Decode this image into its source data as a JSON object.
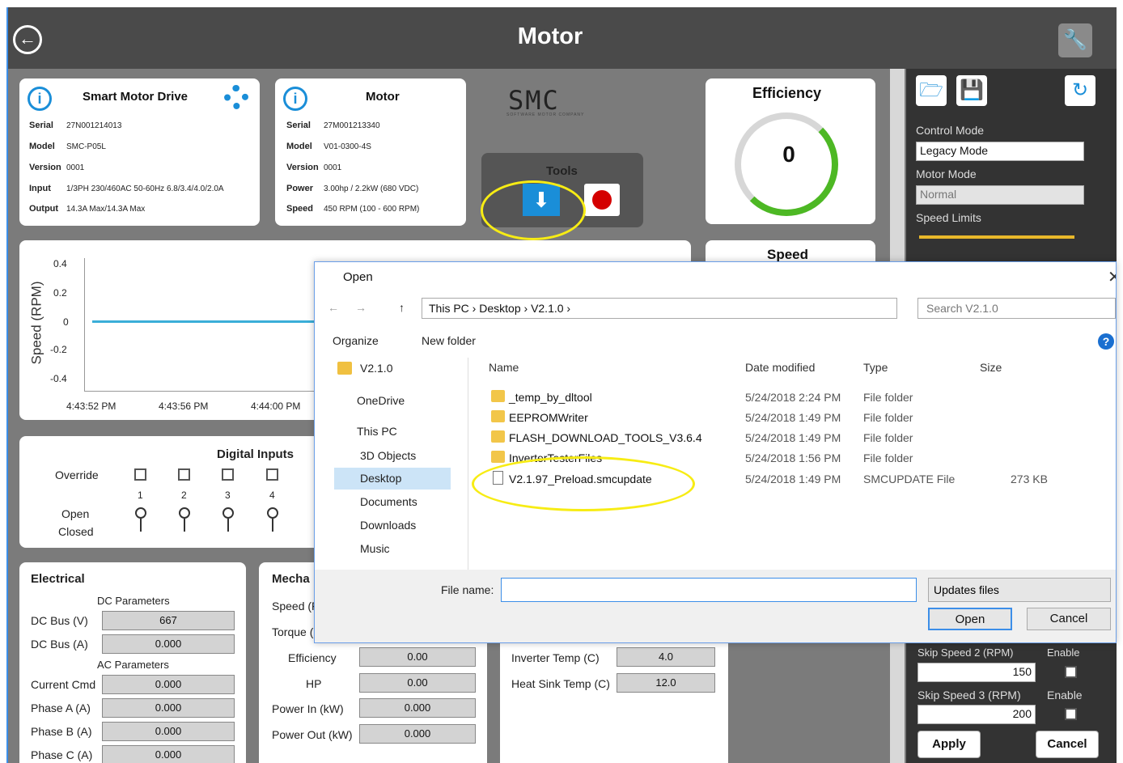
{
  "app": {
    "title": "Motor"
  },
  "drive": {
    "title": "Smart Motor Drive",
    "rows": [
      {
        "k": "Serial",
        "v": "27N001214013"
      },
      {
        "k": "Model",
        "v": "SMC-P05L"
      },
      {
        "k": "Version",
        "v": "0001"
      },
      {
        "k": "Input",
        "v": "1/3PH 230/460AC 50-60Hz 6.8/3.4/4.0/2.0A"
      },
      {
        "k": "Output",
        "v": "14.3A Max/14.3A Max"
      }
    ]
  },
  "motor": {
    "title": "Motor",
    "rows": [
      {
        "k": "Serial",
        "v": "27M001213340"
      },
      {
        "k": "Model",
        "v": "V01-0300-4S"
      },
      {
        "k": "Version",
        "v": "0001"
      },
      {
        "k": "Power",
        "v": "3.00hp / 2.2kW (680 VDC)"
      },
      {
        "k": "Speed",
        "v": "450 RPM (100 - 600 RPM)"
      }
    ]
  },
  "logo": {
    "text": "SMC",
    "tagline": "SOFTWARE MOTOR COMPANY"
  },
  "tools": {
    "label": "Tools"
  },
  "efficiency": {
    "title": "Efficiency",
    "value": "0"
  },
  "speed_card": {
    "title": "Speed"
  },
  "chart": {
    "ylabel": "Speed (RPM)",
    "yticks": [
      "0.4",
      "0.2",
      "0",
      "-0.2",
      "-0.4"
    ],
    "xticks": [
      "4:43:52 PM",
      "4:43:56 PM",
      "4:44:00 PM"
    ]
  },
  "digital": {
    "title": "Digital Inputs",
    "override": "Override",
    "open": "Open",
    "closed": "Closed",
    "nums": [
      "1",
      "2",
      "3",
      "4"
    ]
  },
  "electrical": {
    "title": "Electrical",
    "dc": "DC Parameters",
    "ac": "AC Parameters",
    "rows": [
      {
        "k": "DC Bus (V)",
        "v": "667"
      },
      {
        "k": "DC Bus (A)",
        "v": "0.000"
      },
      {
        "k": "Current Cmd",
        "v": "0.000"
      },
      {
        "k": "Phase A (A)",
        "v": "0.000"
      },
      {
        "k": "Phase B (A)",
        "v": "0.000"
      },
      {
        "k": "Phase C (A)",
        "v": "0.000"
      }
    ]
  },
  "mech": {
    "title": "Mecha",
    "speed": "Speed (F",
    "torque": "Torque (",
    "rows": [
      {
        "k": "Efficiency",
        "v": "0.00"
      },
      {
        "k": "HP",
        "v": "0.00"
      },
      {
        "k": "Power In (kW)",
        "v": "0.000"
      },
      {
        "k": "Power Out (kW)",
        "v": "0.000"
      }
    ]
  },
  "temps": [
    {
      "k": "Inverter Temp (C)",
      "v": "4.0"
    },
    {
      "k": "Heat Sink Temp (C)",
      "v": "12.0"
    }
  ],
  "side": {
    "control_mode_label": "Control Mode",
    "control_mode": "Legacy Mode",
    "motor_mode_label": "Motor Mode",
    "motor_mode": "Normal",
    "speed_limits": "Speed Limits",
    "skip2": "Skip Speed 2 (RPM)",
    "enable": "Enable",
    "skip2_val": "150",
    "skip3": "Skip Speed 3 (RPM)",
    "skip3_val": "200",
    "apply": "Apply",
    "cancel": "Cancel"
  },
  "dialog": {
    "title": "Open",
    "path": [
      "This PC",
      "Desktop",
      "V2.1.0"
    ],
    "search_placeholder": "Search V2.1.0",
    "organize": "Organize",
    "new_folder": "New folder",
    "nav": [
      "V2.1.0",
      "OneDrive",
      "This PC",
      "3D Objects",
      "Desktop",
      "Documents",
      "Downloads",
      "Music"
    ],
    "columns": {
      "name": "Name",
      "date": "Date modified",
      "type": "Type",
      "size": "Size"
    },
    "files": [
      {
        "name": "_temp_by_dltool",
        "date": "5/24/2018 2:24 PM",
        "type": "File folder",
        "size": ""
      },
      {
        "name": "EEPROMWriter",
        "date": "5/24/2018 1:49 PM",
        "type": "File folder",
        "size": ""
      },
      {
        "name": "FLASH_DOWNLOAD_TOOLS_V3.6.4",
        "date": "5/24/2018 1:49 PM",
        "type": "File folder",
        "size": ""
      },
      {
        "name": "InverterTesterFiles",
        "date": "5/24/2018 1:56 PM",
        "type": "File folder",
        "size": ""
      },
      {
        "name": "V2.1.97_Preload.smcupdate",
        "date": "5/24/2018 1:49 PM",
        "type": "SMCUPDATE File",
        "size": "273 KB"
      }
    ],
    "file_name_label": "File name:",
    "file_name": "",
    "filter": "Updates files",
    "open": "Open",
    "cancel": "Cancel"
  },
  "colors": {
    "accent": "#1a8ed8",
    "highlight": "#f7ec14",
    "chart_line": "#3aaed8"
  }
}
